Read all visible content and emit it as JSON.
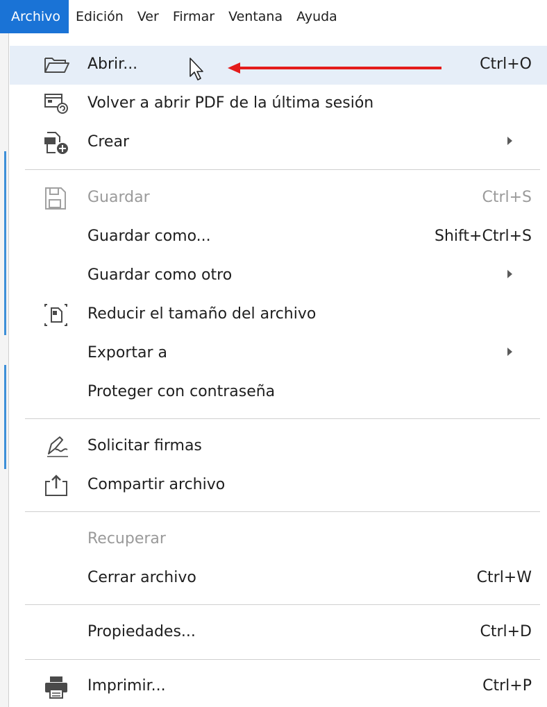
{
  "menubar": {
    "items": [
      "Archivo",
      "Edición",
      "Ver",
      "Firmar",
      "Ventana",
      "Ayuda"
    ]
  },
  "menu": {
    "items": [
      {
        "label": "Abrir...",
        "shortcut": "Ctrl+O",
        "icon": "folder-open-icon",
        "highlighted": true
      },
      {
        "label": "Volver a abrir PDF de la última sesión",
        "shortcut": "",
        "icon": "reopen-pdf-icon"
      },
      {
        "label": "Crear",
        "shortcut": "",
        "icon": "create-pdf-icon",
        "submenu": true
      },
      {
        "label": "Guardar",
        "shortcut": "Ctrl+S",
        "icon": "save-icon",
        "disabled": true
      },
      {
        "label": "Guardar como...",
        "shortcut": "Shift+Ctrl+S",
        "icon": ""
      },
      {
        "label": "Guardar como otro",
        "shortcut": "",
        "icon": "",
        "submenu": true
      },
      {
        "label": "Reducir el tamaño del archivo",
        "shortcut": "",
        "icon": "compress-file-icon"
      },
      {
        "label": "Exportar a",
        "shortcut": "",
        "icon": "",
        "submenu": true
      },
      {
        "label": "Proteger con contraseña",
        "shortcut": "",
        "icon": ""
      },
      {
        "label": "Solicitar firmas",
        "shortcut": "",
        "icon": "signature-icon"
      },
      {
        "label": "Compartir archivo",
        "shortcut": "",
        "icon": "share-icon"
      },
      {
        "label": "Recuperar",
        "shortcut": "",
        "icon": "",
        "disabled": true
      },
      {
        "label": "Cerrar archivo",
        "shortcut": "Ctrl+W",
        "icon": ""
      },
      {
        "label": "Propiedades...",
        "shortcut": "Ctrl+D",
        "icon": ""
      },
      {
        "label": "Imprimir...",
        "shortcut": "Ctrl+P",
        "icon": "printer-icon"
      }
    ]
  },
  "colors": {
    "menubar_active": "#1a73d6",
    "highlight_row": "#e6eef8",
    "annotation_arrow": "#e41b1b",
    "disabled_text": "#9a9a9a"
  }
}
